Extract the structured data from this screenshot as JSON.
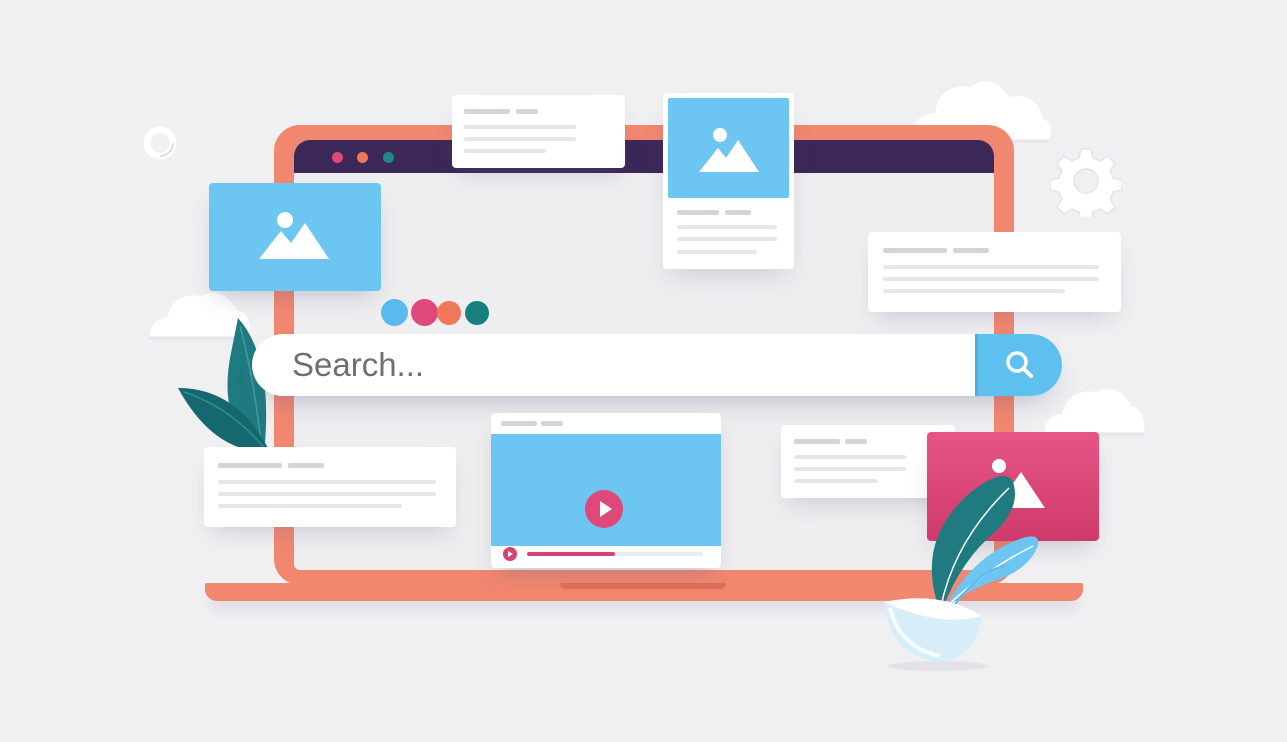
{
  "search": {
    "placeholder": "Search...",
    "button_icon": "search-icon"
  },
  "window_controls": {
    "dot_colors": [
      "#e0487a",
      "#f0775a",
      "#1b8a86"
    ]
  },
  "color_dots": [
    "#5ab9ee",
    "#e0487a",
    "#f0775a",
    "#17807c"
  ],
  "video": {
    "progress": 0.5
  },
  "icons": [
    "ring-icon",
    "cloud-icon",
    "gear-icon",
    "image-icon",
    "play-icon",
    "leaf-icon",
    "bowl-icon"
  ],
  "colors": {
    "background": "#f0f0f2",
    "laptop": "#f2876f",
    "topbar": "#3c2858",
    "image_blue": "#6dc6f1",
    "image_pink": "#e0487a",
    "search_button": "#5ec0ee"
  }
}
